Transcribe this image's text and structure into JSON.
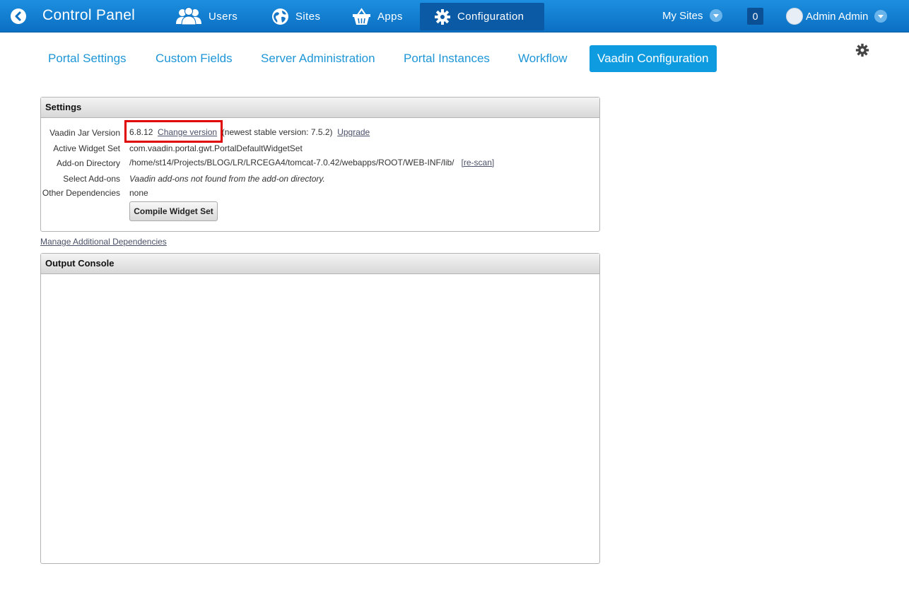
{
  "dockbar": {
    "title": "Control Panel",
    "nav": [
      {
        "label": "Users",
        "icon": "users-icon"
      },
      {
        "label": "Sites",
        "icon": "globe-icon"
      },
      {
        "label": "Apps",
        "icon": "basket-icon"
      },
      {
        "label": "Configuration",
        "icon": "gear-icon",
        "active": true
      }
    ],
    "my_sites": "My Sites",
    "notification_count": "0",
    "user_name": "Admin Admin",
    "colors": {
      "bar": "#0b6fc2",
      "active_item": "#0b5aa6"
    }
  },
  "subnav": {
    "items": [
      "Portal Settings",
      "Custom Fields",
      "Server Administration",
      "Portal Instances",
      "Workflow",
      "Vaadin Configuration"
    ],
    "active": "Vaadin Configuration"
  },
  "settings": {
    "header": "Settings",
    "rows": {
      "jar_version": {
        "label": "Vaadin Jar Version",
        "value": "6.8.12",
        "change_link": "Change version",
        "newest": "(newest stable version: 7.5.2)",
        "upgrade_link": "Upgrade"
      },
      "widget_set": {
        "label": "Active Widget Set",
        "value": "com.vaadin.portal.gwt.PortalDefaultWidgetSet"
      },
      "addon_dir": {
        "label": "Add-on Directory",
        "value": "/home/st14/Projects/BLOG/LR/LRCEGA4/tomcat-7.0.42/webapps/ROOT/WEB-INF/lib/",
        "rescan_link": "[re-scan]"
      },
      "addons": {
        "label": "Select Add-ons",
        "value": "Vaadin add-ons not found from the add-on directory."
      },
      "dependencies": {
        "label": "Other Dependencies",
        "value": "none"
      }
    },
    "compile_button": "Compile Widget Set"
  },
  "manage_link": "Manage Additional Dependencies",
  "console": {
    "header": "Output Console"
  }
}
